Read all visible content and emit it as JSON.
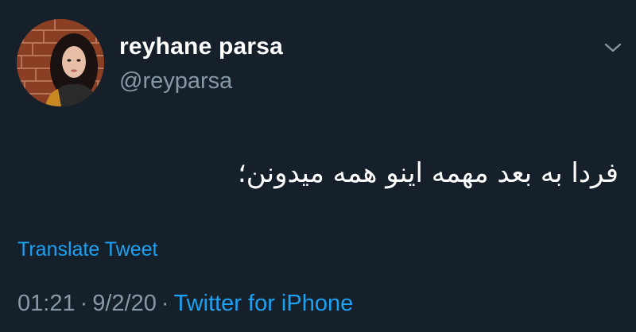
{
  "user": {
    "display_name": "reyhane parsa",
    "handle": "@reyparsa"
  },
  "tweet": {
    "text": "فردا به بعد مهمه اینو همه میدونن؛",
    "translate_label": "Translate Tweet",
    "time": "01:21",
    "date": "9/2/20",
    "separator": "·",
    "source": "Twitter for iPhone"
  },
  "icons": {
    "menu": "chevron-down-icon",
    "avatar": "avatar"
  },
  "colors": {
    "background": "#15202b",
    "text_primary": "#ffffff",
    "text_secondary": "#8899a6",
    "accent": "#1da1f2"
  }
}
